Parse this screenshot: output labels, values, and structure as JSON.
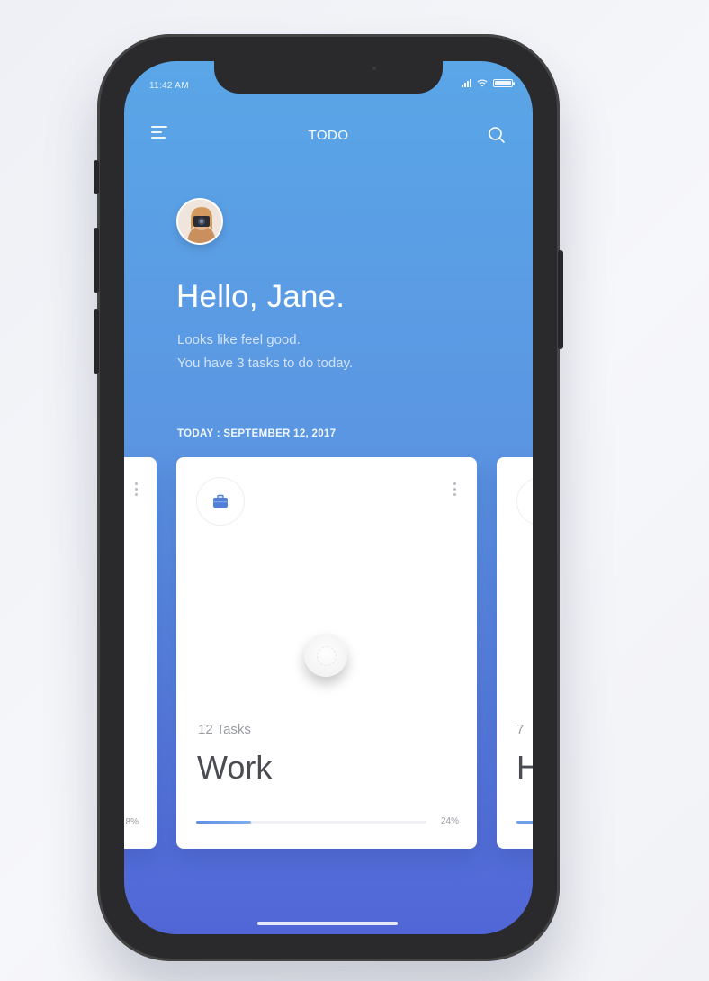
{
  "status_bar": {
    "time": "11:42 AM"
  },
  "header": {
    "title": "TODO"
  },
  "profile": {
    "greeting": "Hello, Jane.",
    "line1": "Looks like feel good.",
    "line2": "You have 3 tasks to do today."
  },
  "date_label": "TODAY : SEPTEMBER 12, 2017",
  "cards": {
    "left_peek": {
      "percent": "8%"
    },
    "main": {
      "icon": "briefcase-icon",
      "task_count": "12 Tasks",
      "title": "Work",
      "progress": 0.24,
      "percent": "24%"
    },
    "right_peek": {
      "task_count": "7",
      "title": "H"
    }
  },
  "colors": {
    "accent": "#5b95e2",
    "gradient_top": "#5aa6e7",
    "gradient_bottom": "#5166d6",
    "progress": "#6ea1ea"
  }
}
